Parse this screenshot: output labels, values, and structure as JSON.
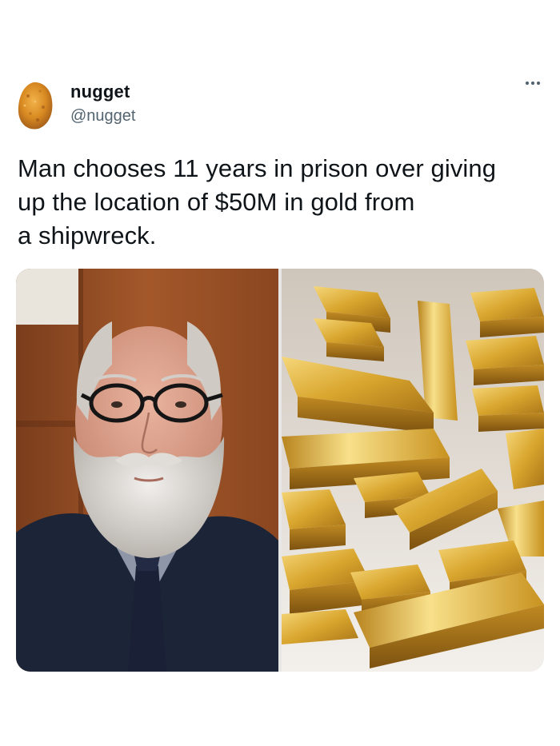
{
  "author": {
    "display_name": "nugget",
    "handle": "@nugget",
    "avatar_icon": "chicken-nugget-avatar"
  },
  "tweet": {
    "text_lines": [
      "Man chooses 11 years in prison over giving",
      "up the location of $50M in gold from",
      "a shipwreck."
    ]
  },
  "menu": {
    "more_icon": "more-horizontal-icon"
  },
  "media": {
    "images": [
      "portrait-photo",
      "gold-bars-photo"
    ]
  },
  "colors": {
    "text_primary": "#0f1419",
    "text_secondary": "#536471",
    "background": "#ffffff",
    "gold": "#d9a62e"
  }
}
